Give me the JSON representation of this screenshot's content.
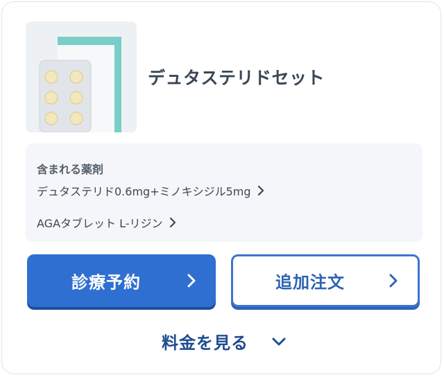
{
  "product": {
    "name": "デュタステリドセット",
    "image_icon": "medication-pack-image"
  },
  "ingredients": {
    "heading": "含まれる薬剤",
    "items": [
      {
        "label": "デュタステリド0.6mg+ミノキシジル5mg"
      },
      {
        "label": "AGAタブレット L-リジン"
      }
    ]
  },
  "buttons": {
    "consult_label": "診療予約",
    "reorder_label": "追加注文"
  },
  "pricing": {
    "toggle_label": "料金を見る"
  },
  "colors": {
    "primary": "#2f6fd1",
    "primary_text": "#2e62b4",
    "title_text": "#3a4655",
    "panel_bg": "#f4f6f9",
    "price_text": "#1e4b91"
  }
}
